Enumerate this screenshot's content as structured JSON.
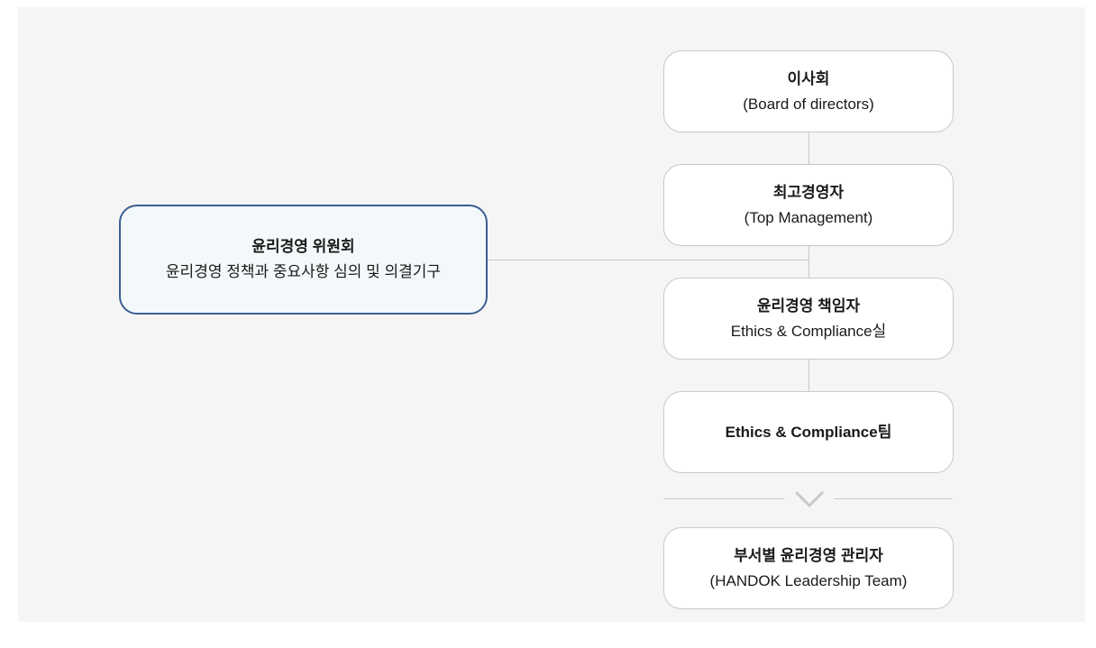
{
  "diagram": {
    "board": {
      "title": "이사회",
      "subtitle": "(Board of directors)"
    },
    "top_management": {
      "title": "최고경영자",
      "subtitle": "(Top Management)"
    },
    "ethics_officer": {
      "title": "윤리경영 책임자",
      "subtitle": "Ethics & Compliance실"
    },
    "ec_team": {
      "title": "Ethics & Compliance팀"
    },
    "dept_managers": {
      "title": "부서별 윤리경영 관리자",
      "subtitle": "(HANDOK Leadership Team)"
    },
    "committee": {
      "title": "윤리경영 위원회",
      "subtitle": "윤리경영 정책과 중요사항 심의 및 의결기구"
    },
    "colors": {
      "panel_background": "#f5f5f5",
      "node_border": "#c8c8c8",
      "committee_border": "#3d5e92",
      "committee_background": "#f3f9fa",
      "connector": "#c8c8c8"
    },
    "icons": {
      "separator": "chevron-down-icon"
    }
  }
}
